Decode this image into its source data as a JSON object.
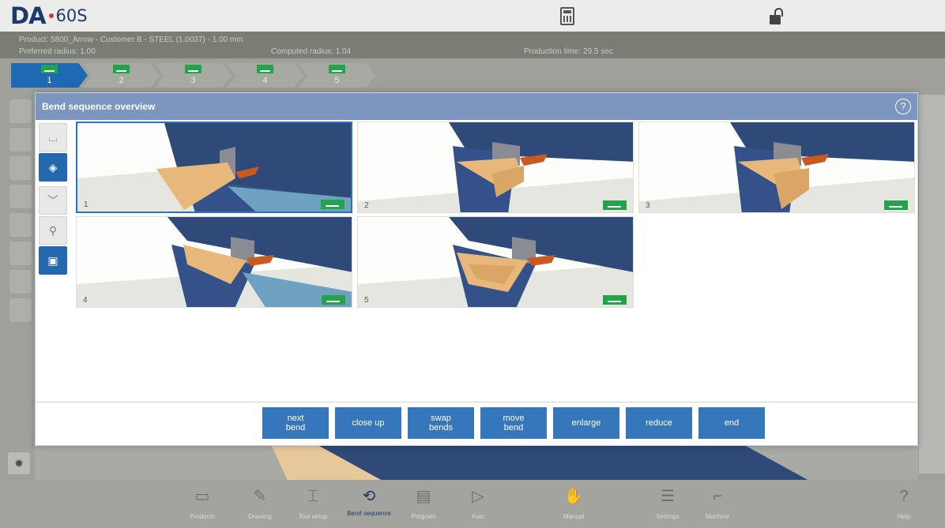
{
  "header": {
    "logo_brand": "DA",
    "logo_model": "60S",
    "calculator_icon": "calculator-icon",
    "lock_icon": "unlock-icon"
  },
  "info": {
    "product": "Product: 5800_Arrow - Customer B - STEEL (1.0037) - 1.00 mm",
    "preferred_radius": "Preferred radius: 1.00",
    "computed_radius": "Computed radius: 1.04",
    "production_time": "Production time: 29.5 sec"
  },
  "steps": [
    {
      "label": "1"
    },
    {
      "label": "2"
    },
    {
      "label": "3"
    },
    {
      "label": "4"
    },
    {
      "label": "5"
    }
  ],
  "modal": {
    "title": "Bend sequence overview",
    "help_icon": "?",
    "thumbnails": [
      {
        "number": "1"
      },
      {
        "number": "2"
      },
      {
        "number": "3"
      },
      {
        "number": "4"
      },
      {
        "number": "5"
      }
    ],
    "actions": [
      {
        "label": "next\nbend"
      },
      {
        "label": "close up"
      },
      {
        "label": "swap\nbends"
      },
      {
        "label": "move\nbend"
      },
      {
        "label": "enlarge"
      },
      {
        "label": "reduce"
      },
      {
        "label": "end"
      }
    ]
  },
  "nav": [
    {
      "label": "Products",
      "icon": "folder-icon"
    },
    {
      "label": "Drawing",
      "icon": "drawing-icon"
    },
    {
      "label": "Tool setup",
      "icon": "tool-setup-icon"
    },
    {
      "label": "Bend sequence",
      "icon": "bend-sequence-icon"
    },
    {
      "label": "Program",
      "icon": "program-icon"
    },
    {
      "label": "Auto",
      "icon": "play-icon"
    },
    {
      "label": "Manual",
      "icon": "hand-icon"
    },
    {
      "label": "Settings",
      "icon": "list-icon"
    },
    {
      "label": "Machine",
      "icon": "machine-icon"
    },
    {
      "label": "Help",
      "icon": "help-icon"
    }
  ],
  "colors": {
    "accent": "#1f69b4",
    "header_blue": "#7c96c0",
    "ok_green": "#23a34a",
    "tool_navy": "#2f4a78",
    "sheet_orange": "#e8b87a"
  }
}
